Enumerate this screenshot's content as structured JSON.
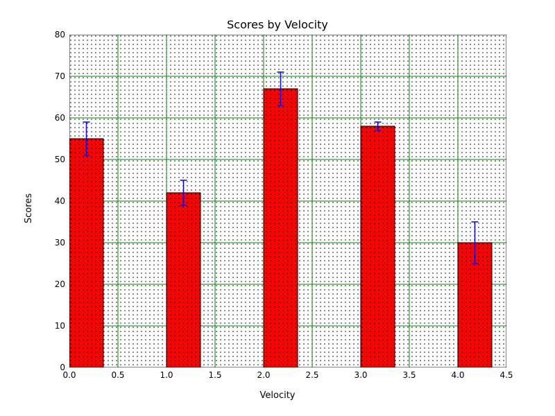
{
  "chart_data": {
    "type": "bar",
    "title": "Scores by Velocity",
    "xlabel": "Velocity",
    "ylabel": "Scores",
    "xlim": [
      0.0,
      4.5
    ],
    "ylim": [
      0,
      80
    ],
    "xticks": [
      0.0,
      0.5,
      1.0,
      1.5,
      2.0,
      2.5,
      3.0,
      3.5,
      4.0,
      4.5
    ],
    "yticks": [
      0,
      10,
      20,
      30,
      40,
      50,
      60,
      70,
      80
    ],
    "bar_x": [
      0,
      1,
      2,
      3,
      4
    ],
    "bar_width": 0.35,
    "values": [
      55,
      42,
      67,
      58,
      30
    ],
    "errors": [
      4,
      3,
      4,
      1,
      5
    ],
    "bar_color": "#ff0000",
    "bar_edge": "#000000",
    "error_color": "#0000ff",
    "grid_color": "#008000",
    "hatch": "dotted"
  }
}
